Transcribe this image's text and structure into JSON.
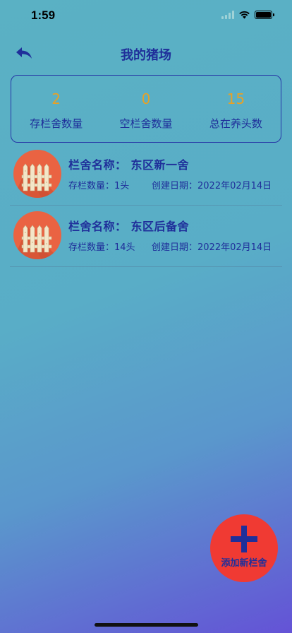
{
  "status_bar": {
    "time": "1:59"
  },
  "nav": {
    "title": "我的猪场"
  },
  "stats": [
    {
      "value": "2",
      "label": "存栏舍数量"
    },
    {
      "value": "0",
      "label": "空栏舍数量"
    },
    {
      "value": "15",
      "label": "总在养头数"
    }
  ],
  "pens": [
    {
      "name_label": "栏舍名称：",
      "name": "东区新一舍",
      "count": "存栏数量：1头",
      "created": "创建日期：2022年02月14日"
    },
    {
      "name_label": "栏舍名称：",
      "name": "东区后备舍",
      "count": "存栏数量：14头",
      "created": "创建日期：2022年02月14日"
    }
  ],
  "fab": {
    "label": "添加新栏舍"
  },
  "colors": {
    "primary_text": "#1f2f9a",
    "stat_value": "#e7a126",
    "fab": "#f03a33",
    "avatar_bg": "#ea6342"
  },
  "icons": {
    "back": "back-arrow-icon",
    "pen": "fence-icon",
    "add": "plus-icon"
  }
}
